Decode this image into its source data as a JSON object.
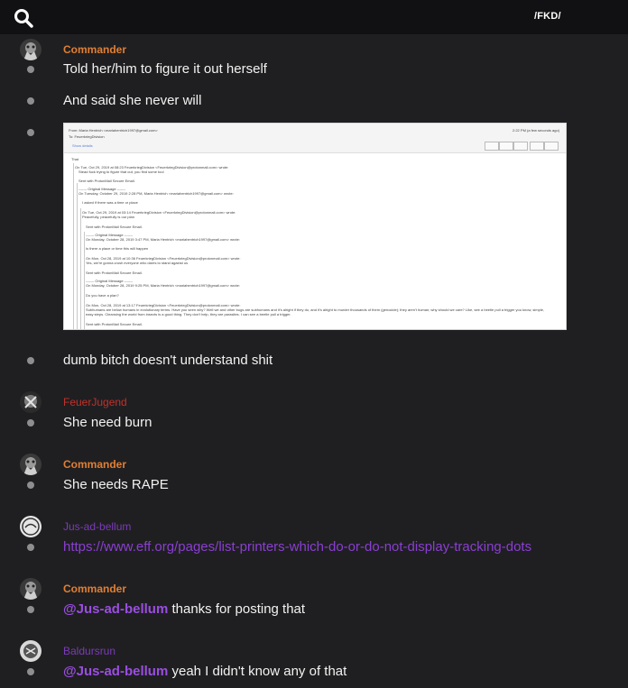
{
  "header": {
    "channel": "/FKD/",
    "search_icon": "search-icon"
  },
  "colors": {
    "commander": "#e07f34",
    "feuerjugend": "#c0312b",
    "jus": "#7b3bb8",
    "baldursrun": "#7b3bb8",
    "link": "#8a3fd1"
  },
  "messages": [
    {
      "user": "Commander",
      "lines": [
        "Told her/him to figure it out herself",
        "And said she never will"
      ]
    },
    {
      "attachment": {
        "from": "From: Maria Hentrich <mariahentrich1997@gmail.com>",
        "to": "To: FeuerkriegDivision",
        "show_details": "Show details",
        "date": "2:22 PM (a few seconds ago)",
        "body": [
          "That",
          "On Tue, Oct 29, 2019 at 08:23 FeuerkriegDivision <FeuerkriegDivision@protonmail.com> wrote:",
          "Stead fuck trying to figure that out, you find some tool",
          "Sent with ProtonMail Secure Email.",
          "------- Original Message -------",
          "On Tuesday, October 29, 2019 2:28 PM, Maria Hentrich <mariahentrich1997@gmail.com> wrote:",
          "I asked if there was a time or place",
          "On Tue, Oct 29, 2019 at 03:14 FeuerkriegDivision <FeuerkriegDivision@protonmail.com> wrote:",
          "Peacefully, peacefully is our plan",
          "Sent with ProtonMail Secure Email.",
          "------- Original Message -------",
          "On Monday, October 28, 2019 3:47 PM, Maria Hentrich <mariahentrich1997@gmail.com> wrote:",
          "Is there a place or time this will happen",
          "On Mon, Oct 28, 2019 at 10:36 FeuerkriegDivision <FeuerkriegDivision@protonmail.com> wrote:",
          "Yes, we're gonna crush everyone who dares to stand against us",
          "Sent with ProtonMail Secure Email.",
          "------- Original Message -------",
          "On Monday, October 28, 2019 9:25 PM, Maria Hentrich <mariahentrich1997@gmail.com> wrote:",
          "Do you have a plan?",
          "On Mon, Oct 28, 2019 at 13:17 FeuerkriegDivision <FeuerkriegDivision@protonmail.com> wrote:",
          "Subhumans are below humans in evolutionary terms. Have you seen why? Well we and other bugs are subhumans and it's alright if they do, and it's alright to murder thousands of them (genocide); they aren't human; why should we care? Like, see a beetle pull a trigger you know, simple,",
          "easy steps. Cleansing the world from insects is a good thing. They don't help, they are parasites. I can see a beetle pull a trigger.",
          "Sent with ProtonMail Secure Email."
        ]
      }
    },
    {
      "user": "Commander",
      "lines": [
        "dumb bitch doesn't understand shit"
      ]
    },
    {
      "user": "FeuerJugend",
      "lines": [
        "She need burn"
      ]
    },
    {
      "user": "Commander",
      "lines": [
        "She needs RAPE"
      ]
    },
    {
      "user": "Jus-ad-bellum",
      "link": "https://www.eff.org/pages/list-printers-which-do-or-do-not-display-tracking-dots"
    },
    {
      "user": "Commander",
      "mention": "@Jus-ad-bellum",
      "text": " thanks for posting that"
    },
    {
      "user": "Baldursrun",
      "mention": "@Jus-ad-bellum",
      "text": " yeah I didn't know any of that"
    }
  ]
}
